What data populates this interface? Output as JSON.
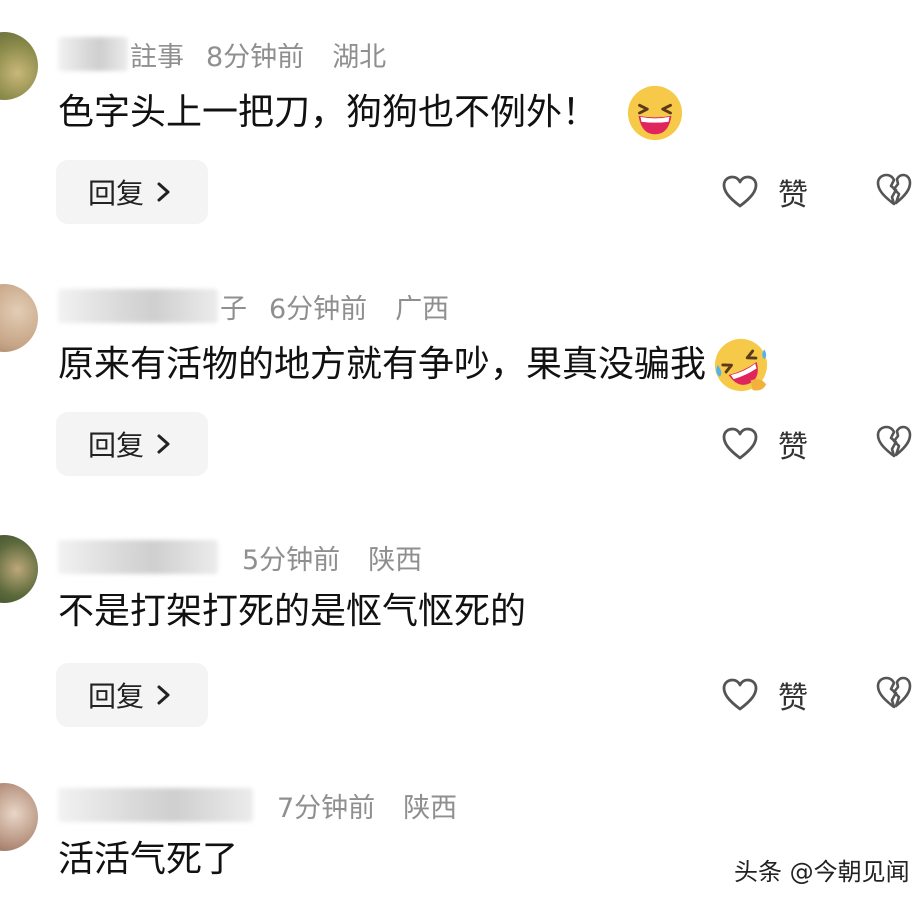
{
  "comments": [
    {
      "name_tail": "註事",
      "time": "8分钟前",
      "region": "湖北",
      "text": "色字头上一把刀，狗狗也不例外！",
      "emoji": "grinning-squint-emoji",
      "reply_label": "回复",
      "like_label": "赞"
    },
    {
      "name_tail": "子",
      "time": "6分钟前",
      "region": "广西",
      "text": "原来有活物的地方就有争吵，果真没骗我",
      "emoji": "rolling-laughing-emoji",
      "reply_label": "回复",
      "like_label": "赞"
    },
    {
      "name_tail": "",
      "time": "5分钟前",
      "region": "陕西",
      "text": "不是打架打死的是怄气怄死的",
      "emoji": "",
      "reply_label": "回复",
      "like_label": "赞"
    },
    {
      "name_tail": "",
      "time": "7分钟前",
      "region": "陕西",
      "text": "活活气死了",
      "emoji": "",
      "reply_label": "",
      "like_label": ""
    }
  ],
  "watermark": "头条 @今朝见闻",
  "colors": {
    "meta_text": "#8f8f8f",
    "body_text": "#111111",
    "reply_bg": "#f4f4f4",
    "emoji_yellow": "#f7c948",
    "emoji_mouth": "#e0245e"
  }
}
